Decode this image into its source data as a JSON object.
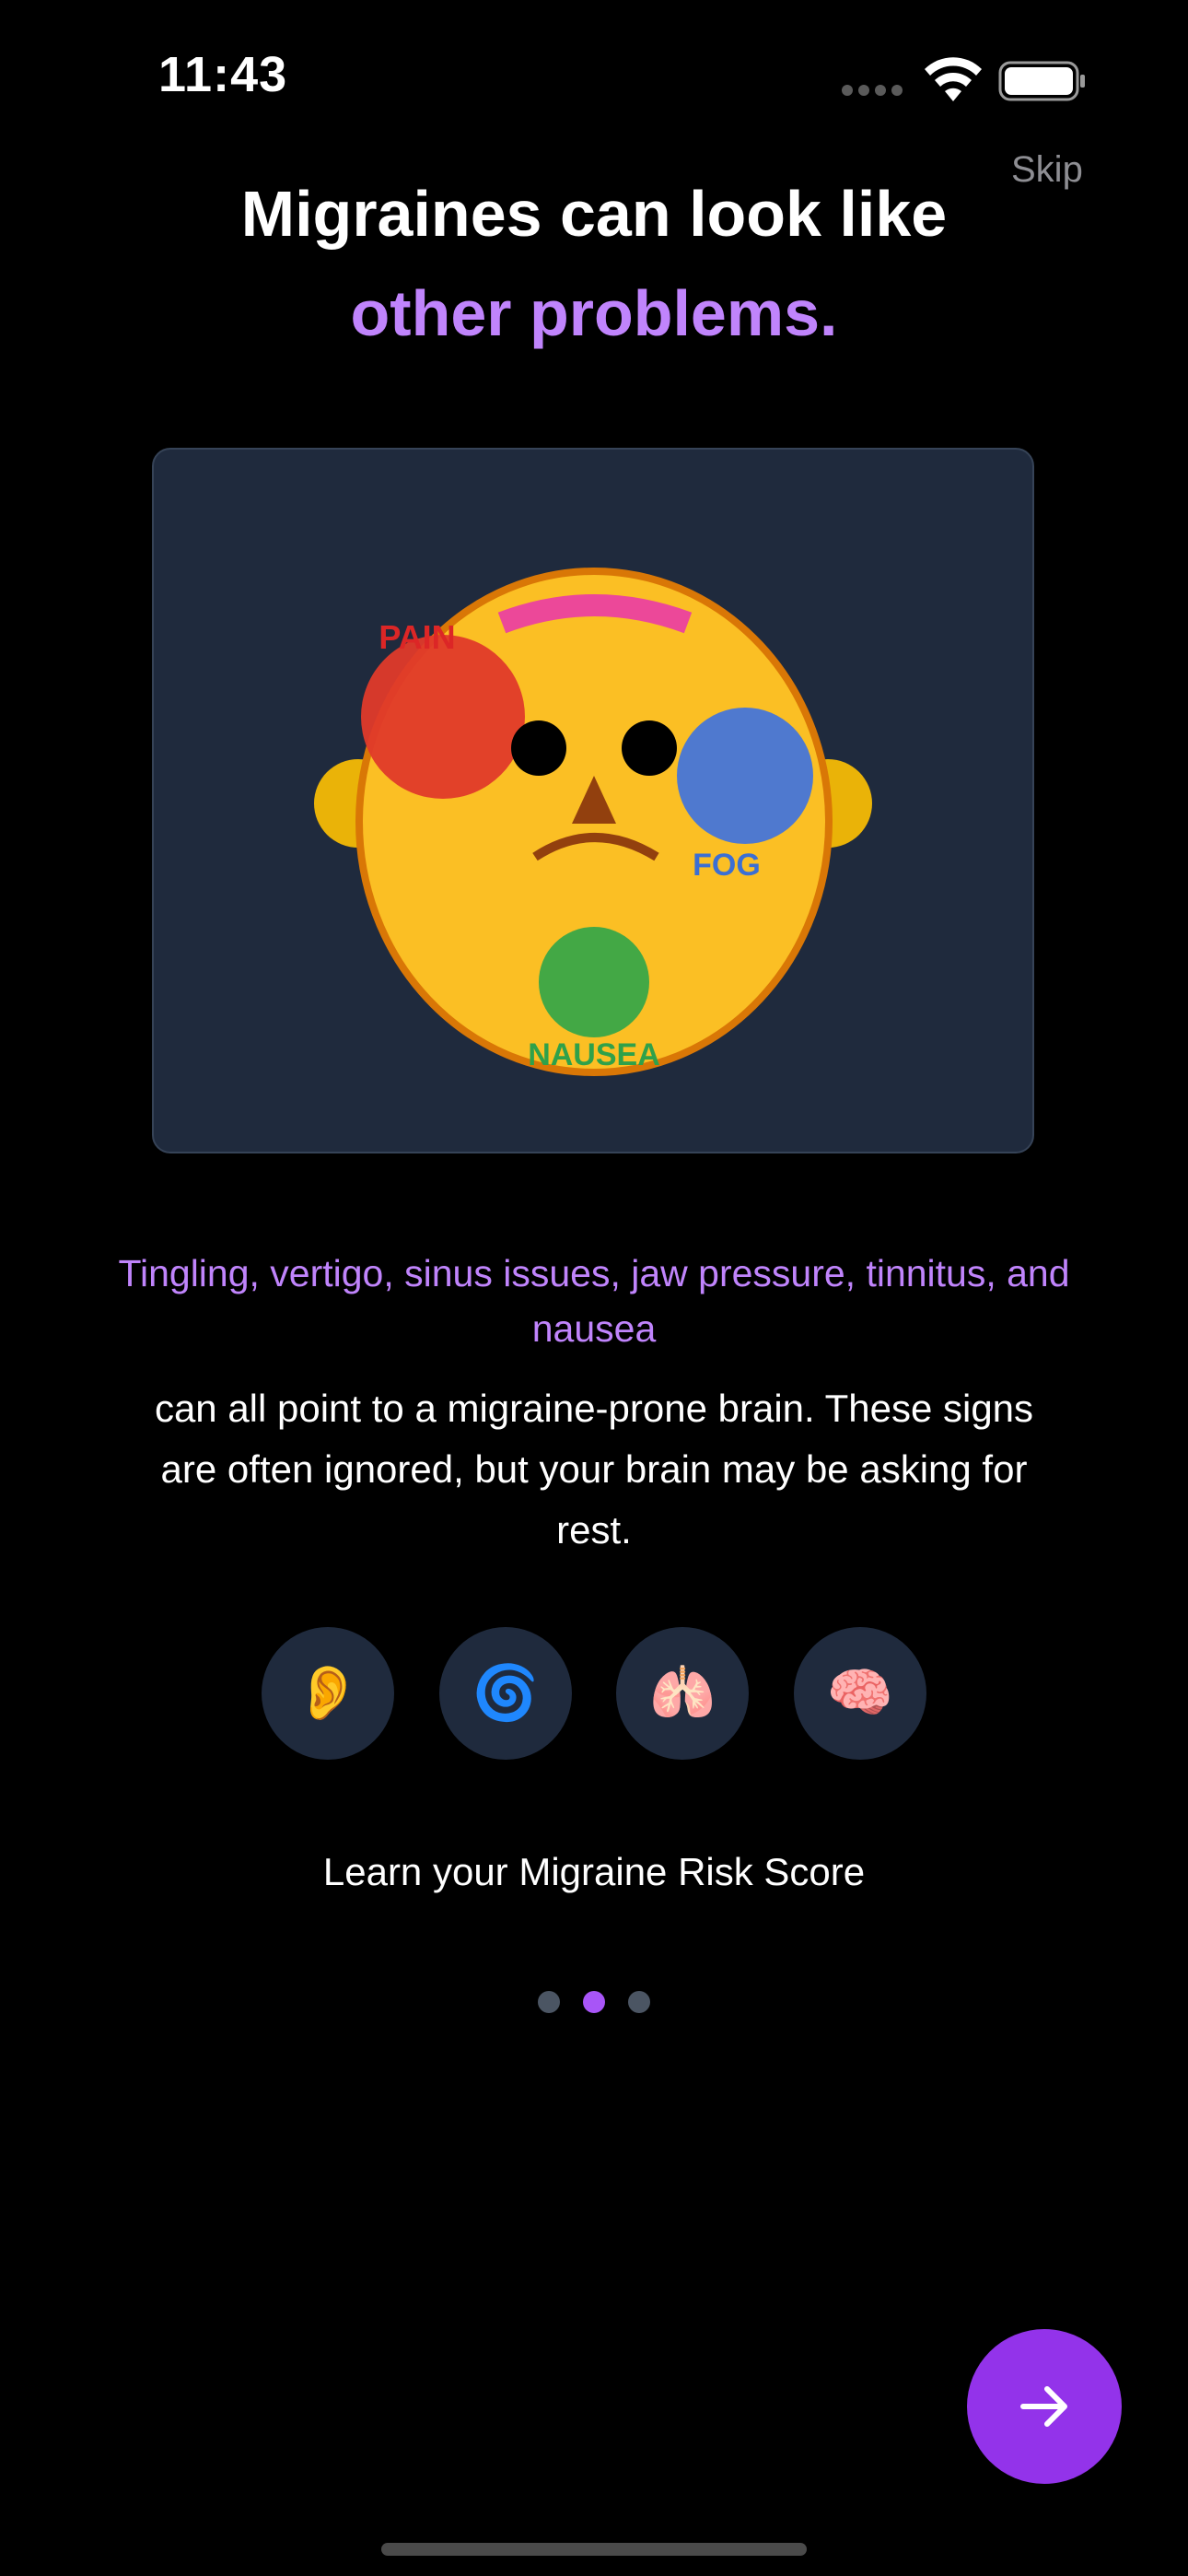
{
  "status_bar": {
    "time": "11:43"
  },
  "skip_label": "Skip",
  "title": {
    "line1": "Migraines can look like",
    "line2": "other problems."
  },
  "illustration": {
    "labels": {
      "pain": "PAIN",
      "fog": "FOG",
      "nausea": "NAUSEA"
    },
    "colors": {
      "face": "#fbbf24",
      "face_border": "#d97706",
      "pain": "#e03a2a",
      "fog": "#4f79cf",
      "nausea": "#43a845",
      "brow": "#ec4899"
    }
  },
  "highlight_text": "Tingling, vertigo, sinus issues, jaw pressure, tinnitus, and nausea",
  "body_text": "can all point to a migraine-prone brain. These signs are often ignored, but your brain may be asking for rest.",
  "symptom_icons": [
    {
      "name": "ear-icon",
      "glyph": "👂"
    },
    {
      "name": "spiral-icon",
      "glyph": "🌀"
    },
    {
      "name": "lungs-icon",
      "glyph": "🫁"
    },
    {
      "name": "brain-icon",
      "glyph": "🧠"
    }
  ],
  "cta_text": "Learn your Migraine Risk Score",
  "pager": {
    "total": 3,
    "active_index": 1
  },
  "next_button_icon": "arrow-right-icon",
  "colors": {
    "accent": "#9333ea",
    "highlight": "#c084fc",
    "background": "#000000",
    "card": "#1f2a3d"
  }
}
